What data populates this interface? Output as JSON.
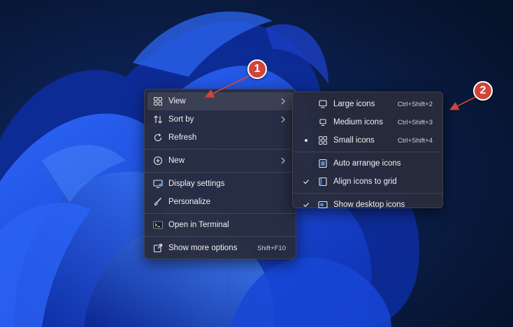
{
  "context_menu": {
    "items": [
      {
        "label": "View",
        "icon": "grid-icon",
        "submenu": true,
        "active": true
      },
      {
        "label": "Sort by",
        "icon": "sort-icon",
        "submenu": true
      },
      {
        "label": "Refresh",
        "icon": "refresh-icon"
      },
      {
        "label": "New",
        "icon": "plus-circle-icon",
        "submenu": true
      },
      {
        "label": "Display settings",
        "icon": "monitor-icon"
      },
      {
        "label": "Personalize",
        "icon": "brush-icon"
      },
      {
        "label": "Open in Terminal",
        "icon": "terminal-icon"
      },
      {
        "label": "Show more options",
        "icon": "share-icon",
        "shortcut": "Shift+F10"
      }
    ]
  },
  "view_submenu": {
    "items": [
      {
        "label": "Large icons",
        "icon": "large-monitor-icon",
        "shortcut": "Ctrl+Shift+2",
        "selected": false
      },
      {
        "label": "Medium icons",
        "icon": "medium-monitor-icon",
        "shortcut": "Ctrl+Shift+3",
        "selected": false
      },
      {
        "label": "Small icons",
        "icon": "small-grid-icon",
        "shortcut": "Ctrl+Shift+4",
        "selected": true
      },
      {
        "label": "Auto arrange icons",
        "icon": "auto-arrange-icon",
        "checked": false
      },
      {
        "label": "Align icons to grid",
        "icon": "align-grid-icon",
        "checked": true
      },
      {
        "label": "Show desktop icons",
        "icon": "desktop-icon",
        "checked": true
      }
    ]
  },
  "annotations": [
    {
      "number": "1",
      "color": "#d0453a"
    },
    {
      "number": "2",
      "color": "#d0453a"
    }
  ],
  "colors": {
    "menu_bg": "#282c3a",
    "accent": "#4a8fe8",
    "wallpaper_dark": "#07142e",
    "wallpaper_blue": "#1747d8"
  }
}
